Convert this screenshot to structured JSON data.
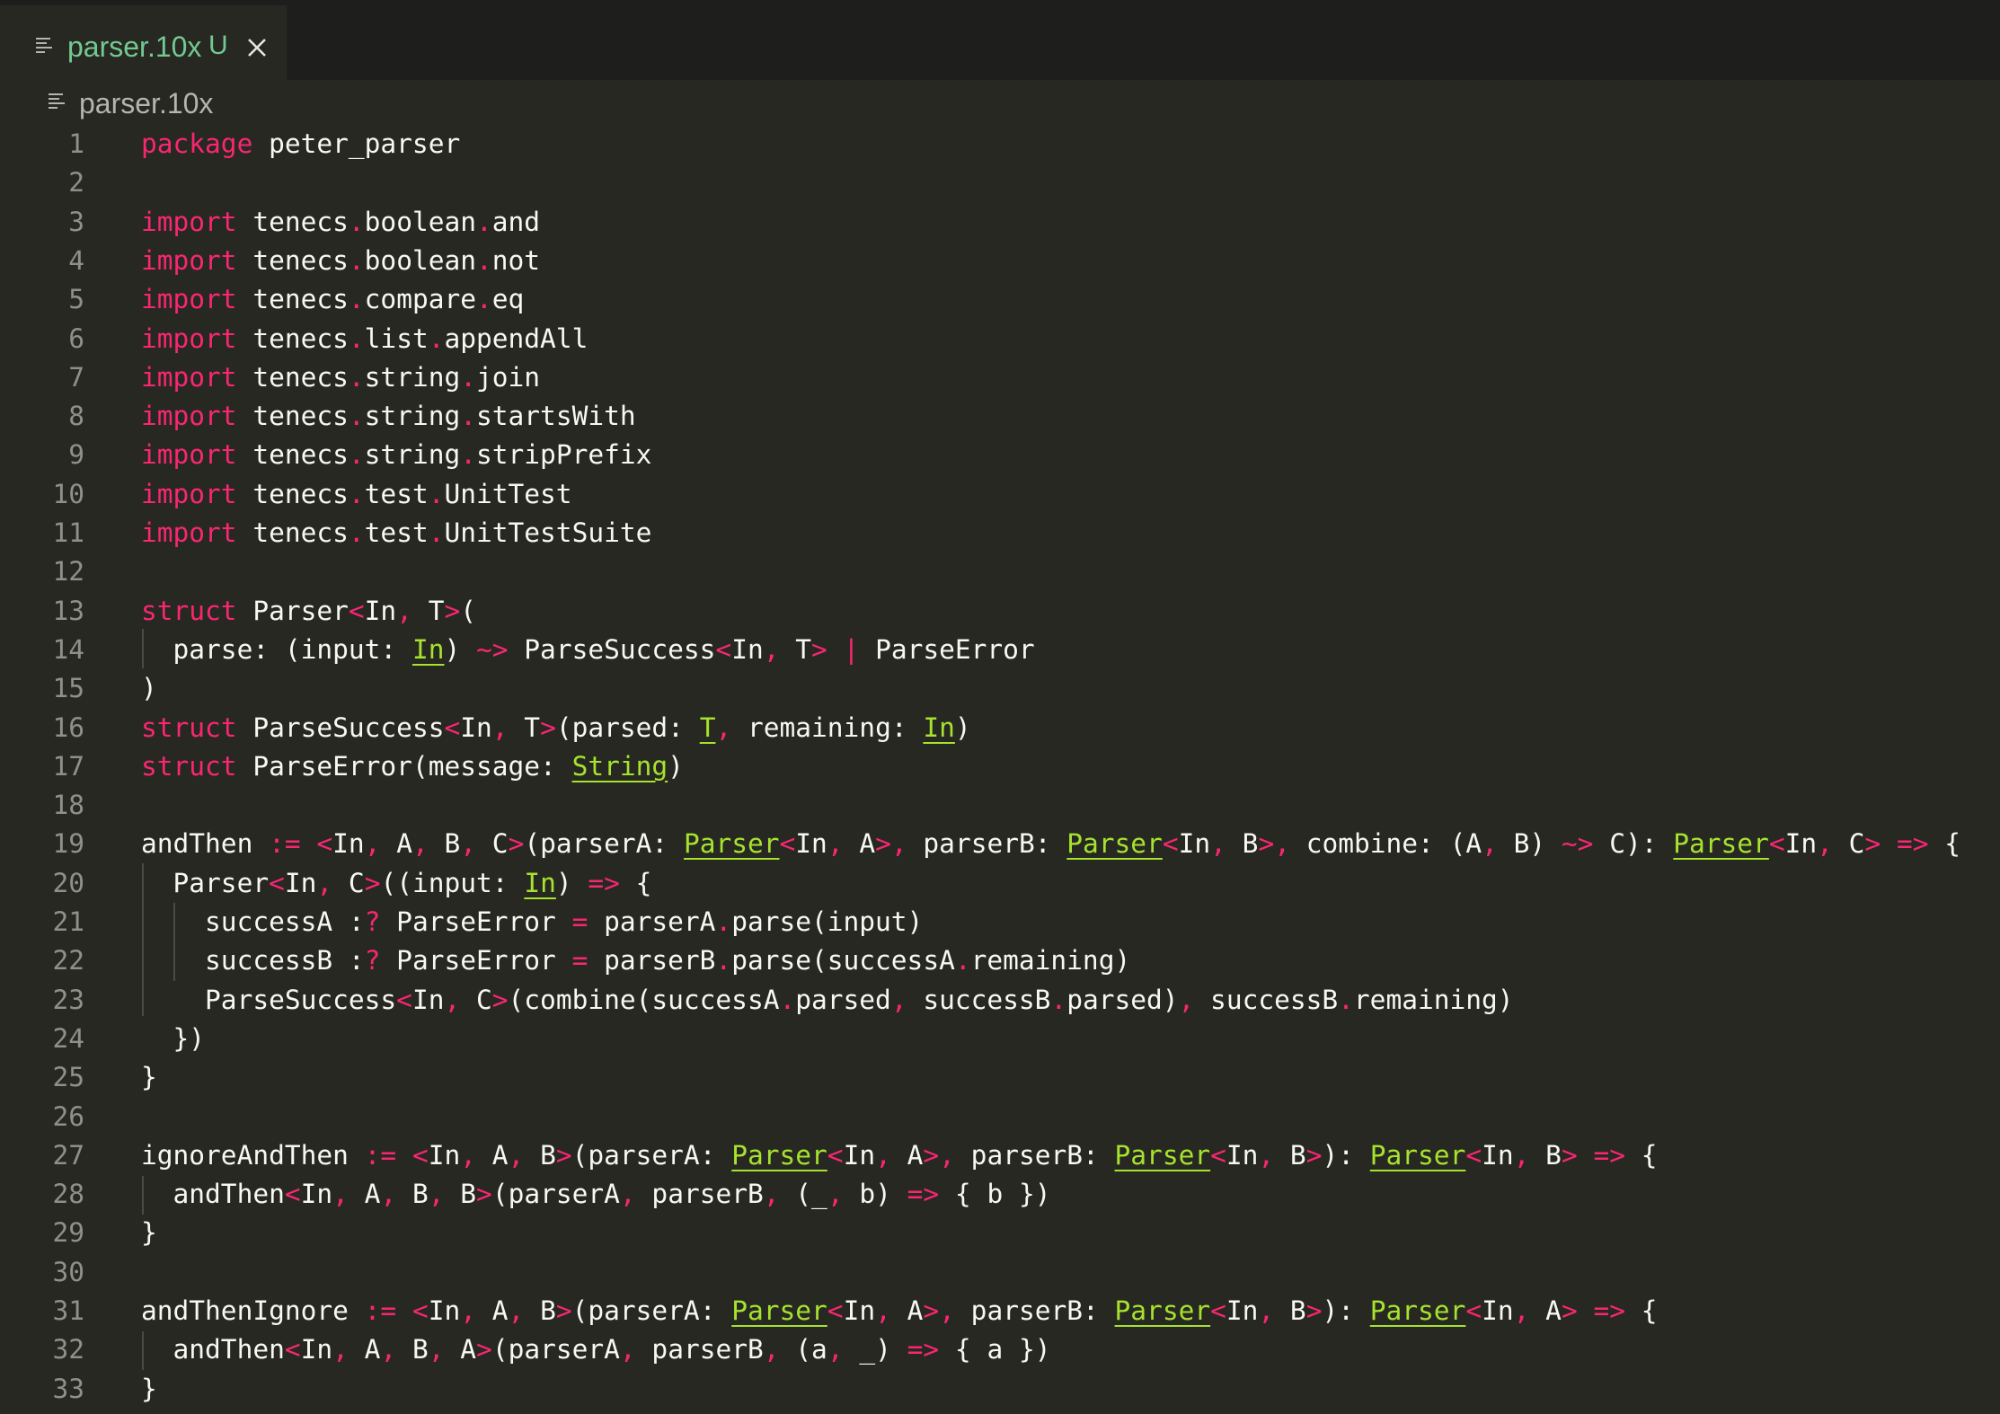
{
  "tab": {
    "filename": "parser.10x",
    "status": "U"
  },
  "breadcrumb": {
    "filename": "parser.10x"
  },
  "icons": {
    "file": "file-lines-icon",
    "close": "close-icon"
  },
  "colors": {
    "background": "#272822",
    "tab_bar": "#1e1f1c",
    "keyword": "#f92672",
    "type": "#a6e22e",
    "text": "#f8f8f2",
    "line_number": "#8f908a",
    "git_untracked": "#73c991"
  },
  "code": [
    [
      [
        "kw",
        "package"
      ],
      [
        "t",
        " peter_parser"
      ]
    ],
    [],
    [
      [
        "kw",
        "import"
      ],
      [
        "t",
        " tenecs"
      ],
      [
        "p",
        "."
      ],
      [
        "t",
        "boolean"
      ],
      [
        "p",
        "."
      ],
      [
        "t",
        "and"
      ]
    ],
    [
      [
        "kw",
        "import"
      ],
      [
        "t",
        " tenecs"
      ],
      [
        "p",
        "."
      ],
      [
        "t",
        "boolean"
      ],
      [
        "p",
        "."
      ],
      [
        "t",
        "not"
      ]
    ],
    [
      [
        "kw",
        "import"
      ],
      [
        "t",
        " tenecs"
      ],
      [
        "p",
        "."
      ],
      [
        "t",
        "compare"
      ],
      [
        "p",
        "."
      ],
      [
        "t",
        "eq"
      ]
    ],
    [
      [
        "kw",
        "import"
      ],
      [
        "t",
        " tenecs"
      ],
      [
        "p",
        "."
      ],
      [
        "t",
        "list"
      ],
      [
        "p",
        "."
      ],
      [
        "t",
        "appendAll"
      ]
    ],
    [
      [
        "kw",
        "import"
      ],
      [
        "t",
        " tenecs"
      ],
      [
        "p",
        "."
      ],
      [
        "t",
        "string"
      ],
      [
        "p",
        "."
      ],
      [
        "t",
        "join"
      ]
    ],
    [
      [
        "kw",
        "import"
      ],
      [
        "t",
        " tenecs"
      ],
      [
        "p",
        "."
      ],
      [
        "t",
        "string"
      ],
      [
        "p",
        "."
      ],
      [
        "t",
        "startsWith"
      ]
    ],
    [
      [
        "kw",
        "import"
      ],
      [
        "t",
        " tenecs"
      ],
      [
        "p",
        "."
      ],
      [
        "t",
        "string"
      ],
      [
        "p",
        "."
      ],
      [
        "t",
        "stripPrefix"
      ]
    ],
    [
      [
        "kw",
        "import"
      ],
      [
        "t",
        " tenecs"
      ],
      [
        "p",
        "."
      ],
      [
        "t",
        "test"
      ],
      [
        "p",
        "."
      ],
      [
        "t",
        "UnitTest"
      ]
    ],
    [
      [
        "kw",
        "import"
      ],
      [
        "t",
        " tenecs"
      ],
      [
        "p",
        "."
      ],
      [
        "t",
        "test"
      ],
      [
        "p",
        "."
      ],
      [
        "t",
        "UnitTestSuite"
      ]
    ],
    [],
    [
      [
        "kw",
        "struct"
      ],
      [
        "t",
        " Parser"
      ],
      [
        "p",
        "<"
      ],
      [
        "t",
        "In"
      ],
      [
        "p",
        ","
      ],
      [
        "t",
        " T"
      ],
      [
        "p",
        ">"
      ],
      [
        "t",
        "("
      ]
    ],
    [
      [
        "t",
        "  parse: (input: "
      ],
      [
        "ty",
        "In"
      ],
      [
        "t",
        ") "
      ],
      [
        "p",
        "~>"
      ],
      [
        "t",
        " ParseSuccess"
      ],
      [
        "p",
        "<"
      ],
      [
        "t",
        "In"
      ],
      [
        "p",
        ","
      ],
      [
        "t",
        " T"
      ],
      [
        "p",
        ">"
      ],
      [
        "t",
        " "
      ],
      [
        "p",
        "|"
      ],
      [
        "t",
        " ParseError"
      ]
    ],
    [
      [
        "t",
        ")"
      ]
    ],
    [
      [
        "kw",
        "struct"
      ],
      [
        "t",
        " ParseSuccess"
      ],
      [
        "p",
        "<"
      ],
      [
        "t",
        "In"
      ],
      [
        "p",
        ","
      ],
      [
        "t",
        " T"
      ],
      [
        "p",
        ">"
      ],
      [
        "t",
        "(parsed: "
      ],
      [
        "ty",
        "T"
      ],
      [
        "p",
        ","
      ],
      [
        "t",
        " remaining: "
      ],
      [
        "ty",
        "In"
      ],
      [
        "t",
        ")"
      ]
    ],
    [
      [
        "kw",
        "struct"
      ],
      [
        "t",
        " ParseError(message: "
      ],
      [
        "ty",
        "String"
      ],
      [
        "t",
        ")"
      ]
    ],
    [],
    [
      [
        "t",
        "andThen "
      ],
      [
        "p",
        ":="
      ],
      [
        "t",
        " "
      ],
      [
        "p",
        "<"
      ],
      [
        "t",
        "In"
      ],
      [
        "p",
        ","
      ],
      [
        "t",
        " A"
      ],
      [
        "p",
        ","
      ],
      [
        "t",
        " B"
      ],
      [
        "p",
        ","
      ],
      [
        "t",
        " C"
      ],
      [
        "p",
        ">"
      ],
      [
        "t",
        "(parserA: "
      ],
      [
        "ty",
        "Parser"
      ],
      [
        "p",
        "<"
      ],
      [
        "t",
        "In"
      ],
      [
        "p",
        ","
      ],
      [
        "t",
        " A"
      ],
      [
        "p",
        ">,"
      ],
      [
        "t",
        " parserB: "
      ],
      [
        "ty",
        "Parser"
      ],
      [
        "p",
        "<"
      ],
      [
        "t",
        "In"
      ],
      [
        "p",
        ","
      ],
      [
        "t",
        " B"
      ],
      [
        "p",
        ">,"
      ],
      [
        "t",
        " combine: (A"
      ],
      [
        "p",
        ","
      ],
      [
        "t",
        " B) "
      ],
      [
        "p",
        "~>"
      ],
      [
        "t",
        " C): "
      ],
      [
        "ty",
        "Parser"
      ],
      [
        "p",
        "<"
      ],
      [
        "t",
        "In"
      ],
      [
        "p",
        ","
      ],
      [
        "t",
        " C"
      ],
      [
        "p",
        ">"
      ],
      [
        "t",
        " "
      ],
      [
        "p",
        "=>"
      ],
      [
        "t",
        " {"
      ]
    ],
    [
      [
        "t",
        "  Parser"
      ],
      [
        "p",
        "<"
      ],
      [
        "t",
        "In"
      ],
      [
        "p",
        ","
      ],
      [
        "t",
        " C"
      ],
      [
        "p",
        ">"
      ],
      [
        "t",
        "((input: "
      ],
      [
        "ty",
        "In"
      ],
      [
        "t",
        ") "
      ],
      [
        "p",
        "=>"
      ],
      [
        "t",
        " {"
      ]
    ],
    [
      [
        "t",
        "    successA :"
      ],
      [
        "p",
        "?"
      ],
      [
        "t",
        " ParseError "
      ],
      [
        "p",
        "="
      ],
      [
        "t",
        " parserA"
      ],
      [
        "p",
        "."
      ],
      [
        "t",
        "parse(input)"
      ]
    ],
    [
      [
        "t",
        "    successB :"
      ],
      [
        "p",
        "?"
      ],
      [
        "t",
        " ParseError "
      ],
      [
        "p",
        "="
      ],
      [
        "t",
        " parserB"
      ],
      [
        "p",
        "."
      ],
      [
        "t",
        "parse(successA"
      ],
      [
        "p",
        "."
      ],
      [
        "t",
        "remaining)"
      ]
    ],
    [
      [
        "t",
        "    ParseSuccess"
      ],
      [
        "p",
        "<"
      ],
      [
        "t",
        "In"
      ],
      [
        "p",
        ","
      ],
      [
        "t",
        " C"
      ],
      [
        "p",
        ">"
      ],
      [
        "t",
        "(combine(successA"
      ],
      [
        "p",
        "."
      ],
      [
        "t",
        "parsed"
      ],
      [
        "p",
        ","
      ],
      [
        "t",
        " successB"
      ],
      [
        "p",
        "."
      ],
      [
        "t",
        "parsed)"
      ],
      [
        "p",
        ","
      ],
      [
        "t",
        " successB"
      ],
      [
        "p",
        "."
      ],
      [
        "t",
        "remaining)"
      ]
    ],
    [
      [
        "t",
        "  })"
      ]
    ],
    [
      [
        "t",
        "}"
      ]
    ],
    [],
    [
      [
        "t",
        "ignoreAndThen "
      ],
      [
        "p",
        ":="
      ],
      [
        "t",
        " "
      ],
      [
        "p",
        "<"
      ],
      [
        "t",
        "In"
      ],
      [
        "p",
        ","
      ],
      [
        "t",
        " A"
      ],
      [
        "p",
        ","
      ],
      [
        "t",
        " B"
      ],
      [
        "p",
        ">"
      ],
      [
        "t",
        "(parserA: "
      ],
      [
        "ty",
        "Parser"
      ],
      [
        "p",
        "<"
      ],
      [
        "t",
        "In"
      ],
      [
        "p",
        ","
      ],
      [
        "t",
        " A"
      ],
      [
        "p",
        ">,"
      ],
      [
        "t",
        " parserB: "
      ],
      [
        "ty",
        "Parser"
      ],
      [
        "p",
        "<"
      ],
      [
        "t",
        "In"
      ],
      [
        "p",
        ","
      ],
      [
        "t",
        " B"
      ],
      [
        "p",
        ">"
      ],
      [
        "t",
        "): "
      ],
      [
        "ty",
        "Parser"
      ],
      [
        "p",
        "<"
      ],
      [
        "t",
        "In"
      ],
      [
        "p",
        ","
      ],
      [
        "t",
        " B"
      ],
      [
        "p",
        ">"
      ],
      [
        "t",
        " "
      ],
      [
        "p",
        "=>"
      ],
      [
        "t",
        " {"
      ]
    ],
    [
      [
        "t",
        "  andThen"
      ],
      [
        "p",
        "<"
      ],
      [
        "t",
        "In"
      ],
      [
        "p",
        ","
      ],
      [
        "t",
        " A"
      ],
      [
        "p",
        ","
      ],
      [
        "t",
        " B"
      ],
      [
        "p",
        ","
      ],
      [
        "t",
        " B"
      ],
      [
        "p",
        ">"
      ],
      [
        "t",
        "(parserA"
      ],
      [
        "p",
        ","
      ],
      [
        "t",
        " parserB"
      ],
      [
        "p",
        ","
      ],
      [
        "t",
        " (_"
      ],
      [
        "p",
        ","
      ],
      [
        "t",
        " b) "
      ],
      [
        "p",
        "=>"
      ],
      [
        "t",
        " { b })"
      ]
    ],
    [
      [
        "t",
        "}"
      ]
    ],
    [],
    [
      [
        "t",
        "andThenIgnore "
      ],
      [
        "p",
        ":="
      ],
      [
        "t",
        " "
      ],
      [
        "p",
        "<"
      ],
      [
        "t",
        "In"
      ],
      [
        "p",
        ","
      ],
      [
        "t",
        " A"
      ],
      [
        "p",
        ","
      ],
      [
        "t",
        " B"
      ],
      [
        "p",
        ">"
      ],
      [
        "t",
        "(parserA: "
      ],
      [
        "ty",
        "Parser"
      ],
      [
        "p",
        "<"
      ],
      [
        "t",
        "In"
      ],
      [
        "p",
        ","
      ],
      [
        "t",
        " A"
      ],
      [
        "p",
        ">,"
      ],
      [
        "t",
        " parserB: "
      ],
      [
        "ty",
        "Parser"
      ],
      [
        "p",
        "<"
      ],
      [
        "t",
        "In"
      ],
      [
        "p",
        ","
      ],
      [
        "t",
        " B"
      ],
      [
        "p",
        ">"
      ],
      [
        "t",
        "): "
      ],
      [
        "ty",
        "Parser"
      ],
      [
        "p",
        "<"
      ],
      [
        "t",
        "In"
      ],
      [
        "p",
        ","
      ],
      [
        "t",
        " A"
      ],
      [
        "p",
        ">"
      ],
      [
        "t",
        " "
      ],
      [
        "p",
        "=>"
      ],
      [
        "t",
        " {"
      ]
    ],
    [
      [
        "t",
        "  andThen"
      ],
      [
        "p",
        "<"
      ],
      [
        "t",
        "In"
      ],
      [
        "p",
        ","
      ],
      [
        "t",
        " A"
      ],
      [
        "p",
        ","
      ],
      [
        "t",
        " B"
      ],
      [
        "p",
        ","
      ],
      [
        "t",
        " A"
      ],
      [
        "p",
        ">"
      ],
      [
        "t",
        "(parserA"
      ],
      [
        "p",
        ","
      ],
      [
        "t",
        " parserB"
      ],
      [
        "p",
        ","
      ],
      [
        "t",
        " (a"
      ],
      [
        "p",
        ","
      ],
      [
        "t",
        " _) "
      ],
      [
        "p",
        "=>"
      ],
      [
        "t",
        " { a })"
      ]
    ],
    [
      [
        "t",
        "}"
      ]
    ]
  ]
}
